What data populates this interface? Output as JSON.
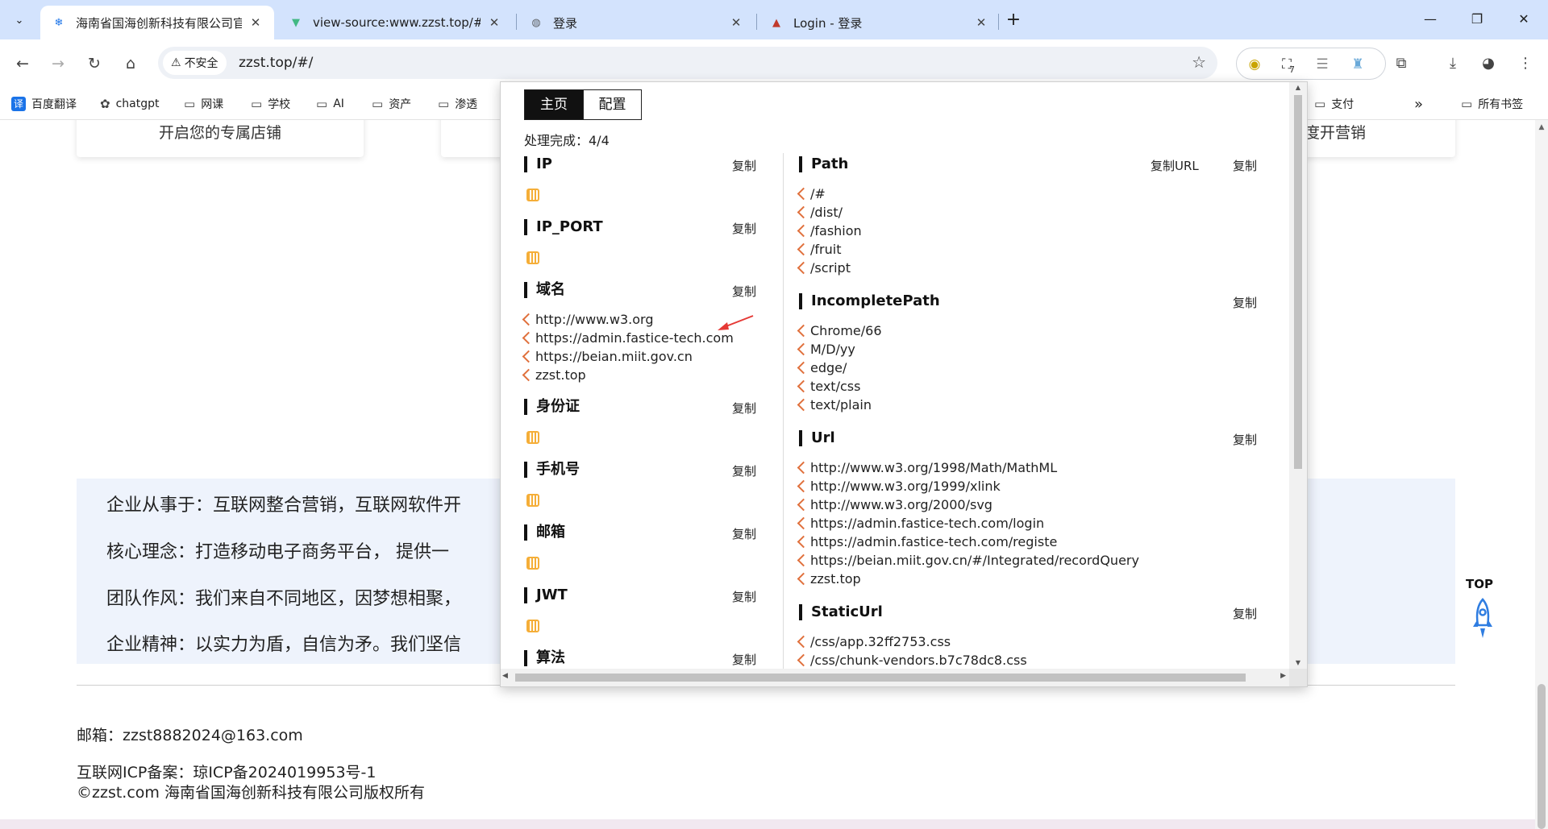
{
  "browser": {
    "tabs": [
      {
        "title": "海南省国海创新科技有限公司官",
        "close": "✕",
        "active": true
      },
      {
        "title": "view-source:www.zzst.top/#/",
        "close": "✕",
        "active": false
      },
      {
        "title": "登录",
        "close": "✕",
        "active": false
      },
      {
        "title": "Login - 登录",
        "close": "✕",
        "active": false
      }
    ],
    "new_tab": "+",
    "window_controls": {
      "minimize": "—",
      "maximize": "❐",
      "close": "✕"
    },
    "security_label": "不安全",
    "url": "zzst.top/#/",
    "extension_badge": "7",
    "bookmarks": [
      {
        "label": "百度翻译",
        "icon": "translate-icon"
      },
      {
        "label": "chatgpt",
        "icon": "openai-icon"
      },
      {
        "label": "网课",
        "icon": "folder-icon"
      },
      {
        "label": "学校",
        "icon": "folder-icon"
      },
      {
        "label": "AI",
        "icon": "folder-icon"
      },
      {
        "label": "资产",
        "icon": "folder-icon"
      },
      {
        "label": "渗透",
        "icon": "folder-icon"
      },
      {
        "label": "支付",
        "icon": "folder-icon"
      },
      {
        "label": "所有书签",
        "icon": "folder-icon"
      }
    ],
    "bookmarks_overflow": "»"
  },
  "page": {
    "cards": [
      "开启您的专属店铺",
      "",
      "企业态度开营销"
    ],
    "info_lines": [
      "企业从事于：互联网整合营销，互联网软件开",
      "核心理念：打造移动电子商务平台， 提供一",
      "团队作风：我们来自不同地区，因梦想相聚，",
      "企业精神：以实力为盾，自信为矛。我们坚信"
    ],
    "footer": {
      "mail": "邮箱：zzst8882024@163.com",
      "icp": "互联网ICP备案：琼ICP备2024019953号-1",
      "copyright": "©zzst.com 海南省国海创新科技有限公司版权所有"
    },
    "top_label": "TOP"
  },
  "popup": {
    "tabs": [
      "主页",
      "配置"
    ],
    "status": "处理完成：4/4",
    "copy_label": "复制",
    "copy_url_label": "复制URL",
    "left_sections": [
      {
        "title": "IP",
        "items": []
      },
      {
        "title": "IP_PORT",
        "items": []
      },
      {
        "title": "域名",
        "items": [
          "http://www.w3.org",
          "https://admin.fastice-tech.com",
          "https://beian.miit.gov.cn",
          "zzst.top"
        ]
      },
      {
        "title": "身份证",
        "items": []
      },
      {
        "title": "手机号",
        "items": []
      },
      {
        "title": "邮箱",
        "items": []
      },
      {
        "title": "JWT",
        "items": []
      },
      {
        "title": "算法",
        "items": []
      }
    ],
    "right_sections": [
      {
        "title": "Path",
        "items": [
          "/#",
          "/dist/",
          "/fashion",
          "/fruit",
          "/script"
        ]
      },
      {
        "title": "IncompletePath",
        "items": [
          "Chrome/66",
          "M/D/yy",
          "edge/",
          "text/css",
          "text/plain"
        ]
      },
      {
        "title": "Url",
        "items": [
          "http://www.w3.org/1998/Math/MathML",
          "http://www.w3.org/1999/xlink",
          "http://www.w3.org/2000/svg",
          "https://admin.fastice-tech.com/login",
          "https://admin.fastice-tech.com/registe",
          "https://beian.miit.gov.cn/#/Integrated/recordQuery",
          "zzst.top"
        ]
      },
      {
        "title": "StaticUrl",
        "items": [
          "/css/app.32ff2753.css",
          "/css/chunk-vendors.b7c78dc8.css"
        ]
      }
    ]
  },
  "colors": {
    "accent": "#d3e3fd",
    "highlight": "#e0703c",
    "empty_icon": "#f5a623",
    "annotation_arrow": "#e53935"
  }
}
